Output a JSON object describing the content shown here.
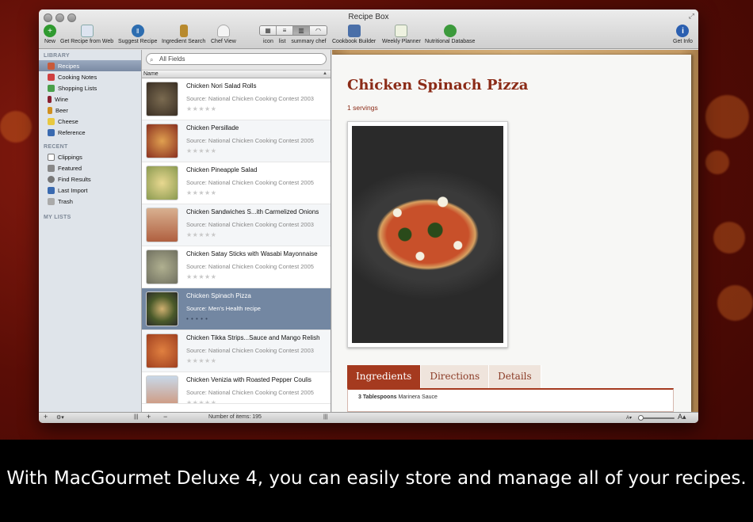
{
  "window": {
    "title": "Recipe Box"
  },
  "toolbar": {
    "items": [
      {
        "label": "New",
        "icon": "new-icon",
        "color": "#2f9a2f"
      },
      {
        "label": "Get Recipe from Web",
        "icon": "web-icon",
        "color": "#5a7bb5"
      },
      {
        "label": "Suggest Recipe",
        "icon": "suggest-icon",
        "color": "#2d6db0"
      },
      {
        "label": "Ingredient Search",
        "icon": "jar-icon",
        "color": "#b88a2e"
      },
      {
        "label": "Chef View",
        "icon": "chef-hat-icon",
        "color": "#bbbbbb"
      }
    ],
    "view_modes": [
      "icon",
      "list",
      "summary",
      "chef"
    ],
    "items_right": [
      {
        "label": "Cookbook Builder",
        "icon": "cookbook-icon",
        "color": "#4a6fa8"
      },
      {
        "label": "Weekly Planner",
        "icon": "planner-icon",
        "color": "#7ca84a"
      },
      {
        "label": "Nutritional Database",
        "icon": "database-icon",
        "color": "#3c9a3c"
      },
      {
        "label": "Get Info",
        "icon": "info-icon",
        "color": "#2b5fb0"
      }
    ]
  },
  "sidebar": {
    "library_heading": "LIBRARY",
    "library": [
      {
        "label": "Recipes",
        "color": "#c85a3a",
        "selected": true
      },
      {
        "label": "Cooking Notes",
        "color": "#d04040"
      },
      {
        "label": "Shopping Lists",
        "color": "#4aa04a"
      },
      {
        "label": "Wine",
        "color": "#8a2030"
      },
      {
        "label": "Beer",
        "color": "#d09020"
      },
      {
        "label": "Cheese",
        "color": "#e8c840"
      },
      {
        "label": "Reference",
        "color": "#3a6ab0"
      }
    ],
    "recent_heading": "RECENT",
    "recent": [
      {
        "label": "Clippings",
        "color": "#777777"
      },
      {
        "label": "Featured",
        "color": "#666666"
      },
      {
        "label": "Find Results",
        "color": "#666666"
      },
      {
        "label": "Last Import",
        "color": "#3a6ab0"
      },
      {
        "label": "Trash",
        "color": "#999999"
      }
    ],
    "mylists_heading": "MY LISTS"
  },
  "search": {
    "placeholder": "All Fields"
  },
  "list": {
    "column_header": "Name",
    "rows": [
      {
        "title": "Chicken Nori Salad Rolls",
        "source": "Source: National Chicken Cooking Contest 2003",
        "stars": "★★★★★",
        "thumb": "#5a4a3a"
      },
      {
        "title": "Chicken Persillade",
        "source": "Source: National Chicken Cooking Contest 2005",
        "stars": "★★★★★",
        "thumb": "#b0603a"
      },
      {
        "title": "Chicken Pineapple Salad",
        "source": "Source: National Chicken Cooking Contest 2005",
        "stars": "★★★★★",
        "thumb": "#c9b070"
      },
      {
        "title": "Chicken Sandwiches S...ith Carmelized Onions",
        "source": "Source: National Chicken Cooking Contest 2003",
        "stars": "★★★★★",
        "thumb": "#c08a5a"
      },
      {
        "title": "Chicken Satay Sticks with Wasabi Mayonnaise",
        "source": "Source: National Chicken Cooking Contest 2005",
        "stars": "★★★★★",
        "thumb": "#9aa070"
      },
      {
        "title": "Chicken Spinach Pizza",
        "source": "Source: Men's Health recipe",
        "stars": "• • • • •",
        "thumb": "#5a6a3a",
        "selected": true
      },
      {
        "title": "Chicken Tikka Strips...Sauce and Mango Relish",
        "source": "Source: National Chicken Cooking Contest 2003",
        "stars": "★★★★★",
        "thumb": "#c06a30"
      },
      {
        "title": "Chicken Venizia with Roasted Pepper Coulis",
        "source": "Source: National Chicken Cooking Contest 2005",
        "stars": "★★★★★",
        "thumb": "#a0b8c8"
      }
    ]
  },
  "recipe": {
    "title": "Chicken Spinach Pizza",
    "servings": "1 servings",
    "tabs": [
      "Ingredients",
      "Directions",
      "Details"
    ],
    "ingredient_qty": "3 Tablespoons",
    "ingredient_name": "Marinera Sauce"
  },
  "status": {
    "count": "Number of items: 195"
  },
  "caption": "With MacGourmet Deluxe 4, you can easily store and manage all of your recipes."
}
